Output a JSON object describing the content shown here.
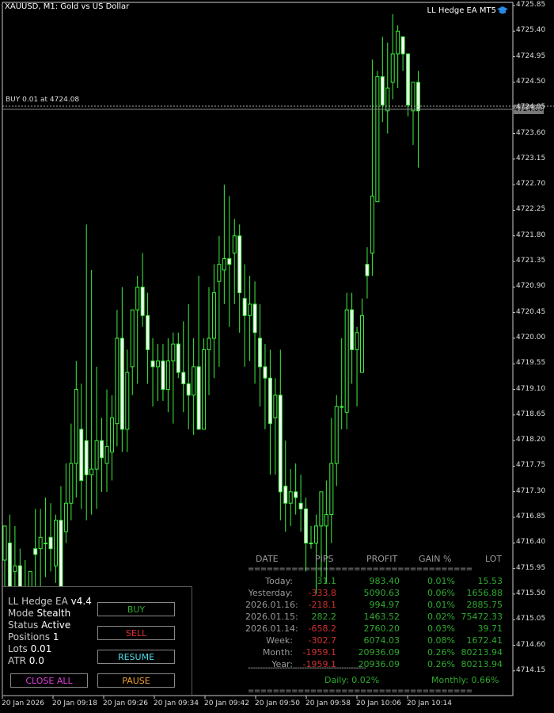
{
  "header": {
    "symbol": "XAUUSD, M1:  Gold vs US Dollar",
    "ea_name": "LL Hedge EA MT5",
    "hat_icon": "graduation-cap-icon"
  },
  "order_line": {
    "label": "BUY 0.01 at 4724.08"
  },
  "current_price": "4724.00",
  "price_axis": [
    "4725.85",
    "4725.40",
    "4724.95",
    "4724.50",
    "4724.05",
    "4723.60",
    "4723.15",
    "4722.70",
    "4722.25",
    "4721.80",
    "4721.35",
    "4720.90",
    "4720.45",
    "4720.00",
    "4719.55",
    "4719.10",
    "4718.65",
    "4718.20",
    "4717.75",
    "4717.30",
    "4716.85",
    "4716.40",
    "4715.95",
    "4715.50",
    "4715.05",
    "4714.60",
    "4714.15"
  ],
  "time_axis": [
    "20 Jan 2026",
    "20 Jan 09:18",
    "20 Jan 09:26",
    "20 Jan 09:34",
    "20 Jan 09:42",
    "20 Jan 09:50",
    "20 Jan 09:58",
    "20 Jan 10:06",
    "20 Jan 10:14"
  ],
  "chart_data": {
    "type": "candlestick",
    "symbol": "XAUUSD",
    "timeframe": "M1",
    "ylim": [
      4714.0,
      4726.0
    ],
    "candles": [
      [
        4716.1,
        4716.7,
        4715.6,
        4716.7
      ],
      [
        4716.4,
        4716.9,
        4715.3,
        4715.5
      ],
      [
        4715.9,
        4716.7,
        4715.1,
        4716.0
      ],
      [
        4716.0,
        4716.3,
        4714.5,
        4715.0
      ],
      [
        4715.4,
        4716.1,
        4715.0,
        4715.6
      ],
      [
        4715.3,
        4715.9,
        4714.8,
        4715.9
      ],
      [
        4716.3,
        4717.0,
        4715.4,
        4716.2
      ],
      [
        4716.3,
        4717.0,
        4715.6,
        4716.5
      ],
      [
        4716.4,
        4717.2,
        4715.8,
        4716.4
      ],
      [
        4716.5,
        4717.1,
        4715.9,
        4716.3
      ],
      [
        4716.0,
        4716.9,
        4715.7,
        4716.8
      ],
      [
        4716.8,
        4717.4,
        4715.6,
        4715.6
      ],
      [
        4716.6,
        4717.8,
        4716.4,
        4717.1
      ],
      [
        4717.1,
        4718.5,
        4716.8,
        4717.8
      ],
      [
        4717.8,
        4719.6,
        4717.2,
        4719.1
      ],
      [
        4718.4,
        4719.2,
        4717.0,
        4717.5
      ],
      [
        4718.2,
        4722.0,
        4716.8,
        4717.6
      ],
      [
        4717.6,
        4721.2,
        4716.9,
        4717.7
      ],
      [
        4717.7,
        4719.5,
        4717.0,
        4718.2
      ],
      [
        4718.2,
        4718.6,
        4717.3,
        4717.9
      ],
      [
        4717.8,
        4719.1,
        4717.3,
        4718.1
      ],
      [
        4718.0,
        4719.0,
        4717.5,
        4718.6
      ],
      [
        4718.5,
        4720.5,
        4718.1,
        4720.0
      ],
      [
        4720.0,
        4720.9,
        4718.0,
        4718.4
      ],
      [
        4718.4,
        4719.8,
        4718.0,
        4719.4
      ],
      [
        4719.5,
        4720.5,
        4719.0,
        4720.5
      ],
      [
        4720.5,
        4721.1,
        4719.2,
        4720.9
      ],
      [
        4720.9,
        4721.5,
        4720.2,
        4720.4
      ],
      [
        4720.4,
        4720.8,
        4719.2,
        4719.8
      ],
      [
        4719.6,
        4720.0,
        4718.8,
        4719.5
      ],
      [
        4719.5,
        4719.9,
        4718.9,
        4719.6
      ],
      [
        4719.6,
        4719.9,
        4718.9,
        4719.1
      ],
      [
        4719.1,
        4720.0,
        4718.7,
        4719.6
      ],
      [
        4719.6,
        4720.1,
        4718.5,
        4719.9
      ],
      [
        4719.9,
        4720.1,
        4719.3,
        4719.4
      ],
      [
        4719.4,
        4720.3,
        4718.7,
        4719.2
      ],
      [
        4719.2,
        4720.6,
        4718.4,
        4719.0
      ],
      [
        4719.0,
        4720.0,
        4718.3,
        4719.5
      ],
      [
        4719.5,
        4721.1,
        4718.4,
        4718.4
      ],
      [
        4718.4,
        4720.0,
        4718.5,
        4719.8
      ],
      [
        4719.8,
        4720.9,
        4719.0,
        4720.0
      ],
      [
        4720.0,
        4721.3,
        4719.3,
        4720.8
      ],
      [
        4721.0,
        4721.8,
        4719.5,
        4721.3
      ],
      [
        4721.2,
        4722.7,
        4720.6,
        4721.4
      ],
      [
        4721.4,
        4722.5,
        4720.2,
        4721.3
      ],
      [
        4721.5,
        4722.1,
        4720.6,
        4721.8
      ],
      [
        4721.8,
        4722.0,
        4720.1,
        4720.8
      ],
      [
        4720.7,
        4721.3,
        4719.5,
        4720.4
      ],
      [
        4720.4,
        4721.1,
        4719.6,
        4720.6
      ],
      [
        4720.6,
        4721.0,
        4719.2,
        4720.1
      ],
      [
        4720.0,
        4720.6,
        4718.8,
        4719.5
      ],
      [
        4719.5,
        4719.9,
        4718.4,
        4719.3
      ],
      [
        4719.3,
        4719.8,
        4717.6,
        4718.5
      ],
      [
        4718.6,
        4719.3,
        4717.6,
        4719.0
      ],
      [
        4719.0,
        4719.8,
        4716.8,
        4717.3
      ],
      [
        4717.4,
        4718.2,
        4716.6,
        4717.1
      ],
      [
        4717.1,
        4717.7,
        4716.7,
        4717.3
      ],
      [
        4717.3,
        4717.8,
        4716.9,
        4717.2
      ],
      [
        4717.1,
        4717.6,
        4716.6,
        4717.0
      ],
      [
        4717.0,
        4717.2,
        4715.9,
        4716.4
      ],
      [
        4716.4,
        4716.7,
        4716.3,
        4716.4
      ],
      [
        4716.4,
        4716.9,
        4715.5,
        4716.7
      ],
      [
        4716.7,
        4717.1,
        4715.8,
        4717.3
      ],
      [
        4716.7,
        4717.5,
        4715.7,
        4716.9
      ],
      [
        4716.9,
        4718.6,
        4716.4,
        4717.8
      ],
      [
        4717.8,
        4719.0,
        4717.4,
        4718.8
      ],
      [
        4718.8,
        4720.0,
        4718.4,
        4718.8
      ],
      [
        4718.7,
        4720.8,
        4718.4,
        4720.5
      ],
      [
        4720.5,
        4720.8,
        4719.2,
        4719.8
      ],
      [
        4719.8,
        4720.2,
        4718.8,
        4720.1
      ],
      [
        4719.4,
        4720.7,
        4719.4,
        4720.4
      ],
      [
        4721.3,
        4721.6,
        4720.7,
        4721.1
      ],
      [
        4721.5,
        4724.9,
        4721.1,
        4722.5
      ],
      [
        4722.4,
        4724.7,
        4722.7,
        4724.6
      ],
      [
        4724.6,
        4725.3,
        4723.8,
        4724.1
      ],
      [
        4724.0,
        4725.2,
        4723.6,
        4724.4
      ],
      [
        4724.5,
        4725.7,
        4724.2,
        4725.0
      ],
      [
        4725.0,
        4725.5,
        4724.4,
        4725.4
      ],
      [
        4725.3,
        4725.1,
        4724.7,
        4725.0
      ],
      [
        4725.0,
        4725.0,
        4723.9,
        4724.1
      ],
      [
        4724.0,
        4724.4,
        4723.4,
        4724.5
      ],
      [
        4724.5,
        4724.7,
        4723.0,
        4724.0
      ]
    ],
    "order_price": 4724.08,
    "bid_price": 4724.0
  },
  "panel": {
    "title": "LL Hedge EA",
    "version": "v4.4",
    "mode_label": "Mode",
    "mode_value": "Stealth",
    "status_label": "Status",
    "status_value": "Active",
    "positions_label": "Positions",
    "positions_value": "1",
    "lots_label": "Lots",
    "lots_value": "0.01",
    "atr_label": "ATR",
    "atr_value": "0.0",
    "buttons": {
      "buy": "BUY",
      "sell": "SELL",
      "resume": "RESUME",
      "close_all": "CLOSE ALL",
      "pause": "PAUSE"
    },
    "colors": {
      "buy": "#2fa82f",
      "sell": "#e03030",
      "resume": "#4fd8e8",
      "close_all": "#e040e0",
      "pause": "#f0a030"
    }
  },
  "stats": {
    "headers": [
      "DATE",
      "PIPS",
      "PROFIT",
      "GAIN %",
      "LOT"
    ],
    "separator": "====================================",
    "separator2": "------------------------------------------------",
    "rows": [
      {
        "date": "Today:",
        "pips": "31.1",
        "profit": "983.40",
        "gain": "0.01%",
        "lot": "15.53",
        "sign": "pos"
      },
      {
        "date": "Yesterday:",
        "pips": "-333.8",
        "profit": "5090.63",
        "gain": "0.06%",
        "lot": "1656.88",
        "sign": "neg"
      },
      {
        "date": "2026.01.16:",
        "pips": "-218.1",
        "profit": "994.97",
        "gain": "0.01%",
        "lot": "2885.75",
        "sign": "neg"
      },
      {
        "date": "2026.01.15:",
        "pips": "282.2",
        "profit": "1463.52",
        "gain": "0.02%",
        "lot": "75472.33",
        "sign": "pos"
      },
      {
        "date": "2026.01.14:",
        "pips": "-658.2",
        "profit": "2760.20",
        "gain": "0.03%",
        "lot": "39.71",
        "sign": "neg"
      },
      {
        "date": "Week:",
        "pips": "-302.7",
        "profit": "6074.03",
        "gain": "0.08%",
        "lot": "1672.41",
        "sign": "neg"
      },
      {
        "date": "Month:",
        "pips": "-1959.1",
        "profit": "20936.09",
        "gain": "0.26%",
        "lot": "80213.94",
        "sign": "neg"
      },
      {
        "date": "Year:",
        "pips": "-1959.1",
        "profit": "20936.09",
        "gain": "0.26%",
        "lot": "80213.94",
        "sign": "neg"
      }
    ],
    "daily": "Daily: 0.02%",
    "monthly": "Monthly: 0.66%"
  }
}
